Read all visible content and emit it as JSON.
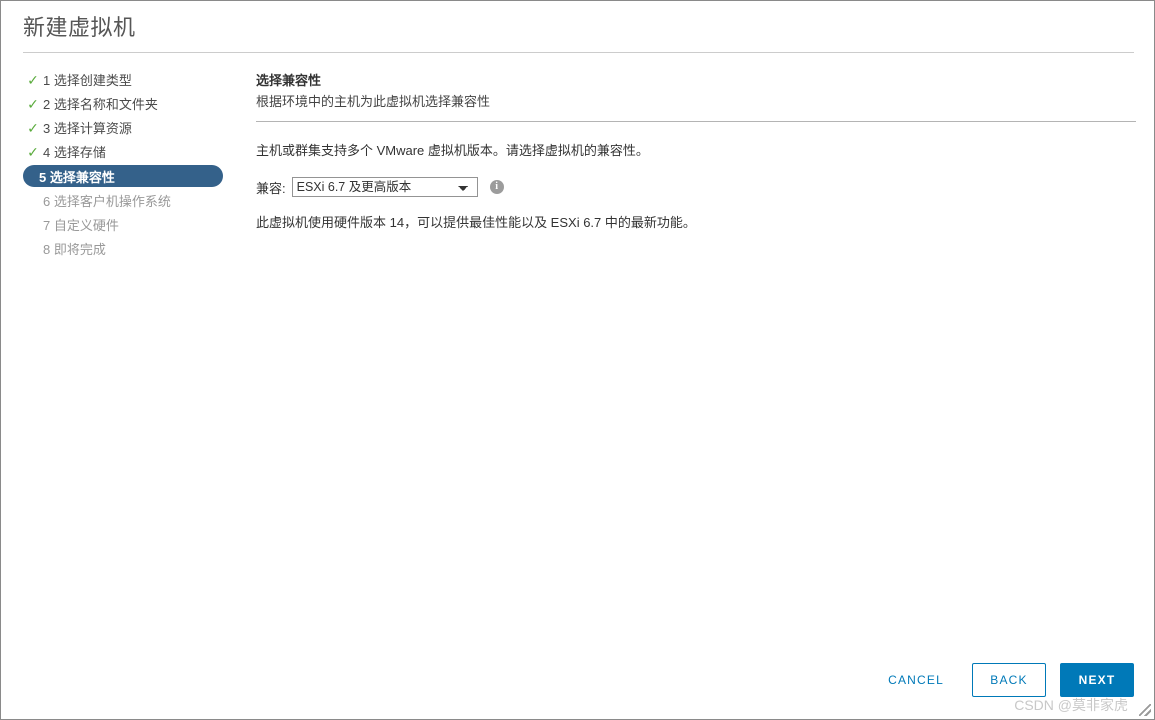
{
  "window": {
    "title": "新建虚拟机"
  },
  "steps": [
    {
      "num": "1",
      "label": "1 选择创建类型",
      "state": "done"
    },
    {
      "num": "2",
      "label": "2 选择名称和文件夹",
      "state": "done"
    },
    {
      "num": "3",
      "label": "3 选择计算资源",
      "state": "done"
    },
    {
      "num": "4",
      "label": "4 选择存储",
      "state": "done"
    },
    {
      "num": "5",
      "label": "5 选择兼容性",
      "state": "active"
    },
    {
      "num": "6",
      "label": "6 选择客户机操作系统",
      "state": "pending"
    },
    {
      "num": "7",
      "label": "7 自定义硬件",
      "state": "pending"
    },
    {
      "num": "8",
      "label": "8 即将完成",
      "state": "pending"
    }
  ],
  "content": {
    "title": "选择兼容性",
    "subtitle": "根据环境中的主机为此虚拟机选择兼容性",
    "paragraph": "主机或群集支持多个 VMware 虚拟机版本。请选择虚拟机的兼容性。",
    "compat_label": "兼容:",
    "compat_value": "ESXi 6.7 及更高版本",
    "compat_options": [
      "ESXi 6.7 及更高版本"
    ],
    "info_icon": "info-icon",
    "note": "此虚拟机使用硬件版本 14，可以提供最佳性能以及 ESXi 6.7 中的最新功能。"
  },
  "footer": {
    "cancel_label": "CANCEL",
    "back_label": "BACK",
    "next_label": "NEXT"
  },
  "watermark": {
    "text": "CSDN @莫非家虎"
  },
  "colors": {
    "accent": "#0079b8",
    "active_step": "#34618a",
    "check": "#5aab3c",
    "border": "#8a8a8a",
    "muted_text": "#999999"
  }
}
